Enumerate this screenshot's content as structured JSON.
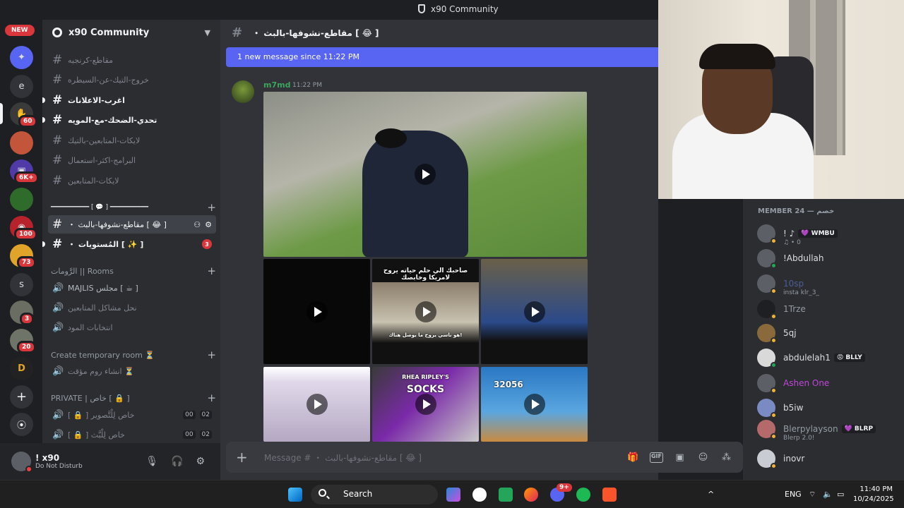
{
  "window": {
    "title": "x90 Community"
  },
  "rail": {
    "new_badge": "NEW",
    "letter_e": "e",
    "letter_s": "s",
    "badges": [
      "60",
      "6K+",
      "100",
      "73",
      "3",
      "20"
    ],
    "add_server": "+",
    "discover": "⦿"
  },
  "guild": {
    "name": "x90 Community",
    "text_channels": [
      "مقاطع-كرنجيه",
      "خروج-التيك-عن-السيطره",
      "اغرب-الاعلانات",
      "تحدي-الضحك-مع-المويه",
      "لايكات-المتابعين-بالتيك",
      "البرامج-اكثر-استعمال",
      "لايكات-المتابعين"
    ],
    "divider_label": "━━━━━━━━━━ [ 💬 ] ━━━━━━━━━━",
    "active_channel": "・ مقاطع-نشوفها-بالبث [ 😂 ]",
    "levels_channel": "・ المُستويات [ ✨ ]",
    "levels_count": "3",
    "rooms_category": "الرَّومات || Rooms",
    "voice_channels": [
      "MAJLIS مجلس [ ☕ ]",
      "نحل مشاكل المتابعين",
      "انتخابات المود"
    ],
    "temp_category": "Create temporary room ⏳",
    "temp_channel": "انشاء روم مؤقت ⏳",
    "private_category": "PRIVATE | خاص [ 🔒 ]",
    "private_channels": [
      {
        "name": "[ 🔒 ] خاص لِلْتَّصوير",
        "a": "00",
        "b": "02"
      },
      {
        "name": "[ 🔒 ] خاص لِلْبَّث",
        "a": "00",
        "b": "02"
      }
    ]
  },
  "user": {
    "name": "! x90",
    "status": "Do Not Disturb"
  },
  "chat": {
    "channel_title": "・ مقاطع-نشوفها-بالبث [ 😂 ]",
    "new_message_bar": "1 new message since 11:22 PM",
    "author": "m7md",
    "time": "11:22 PM",
    "caption_1": "صاحبك الي حلم حياته يروح لامريكا وخابصك",
    "caption_1b": "هو ناسي يروح ما يوصل هناك!",
    "caption_2": "32056",
    "caption_3": "SOCKS",
    "caption_3b": "RHEA RIPLEY'S",
    "placeholder": "Message # ・ مقاطع-نشوفها-بالبث [ 😂 ]",
    "tools": [
      "🎁",
      "GIF",
      "▣",
      "☺",
      "⁂"
    ]
  },
  "members": {
    "header": "MEMBER 24 — خصم",
    "list": [
      {
        "name": "! ♪",
        "tag": "💜 WMBU",
        "sub": "♫ • 0",
        "color": "#dbdee1"
      },
      {
        "name": "!Abdullah",
        "tag": "",
        "sub": "",
        "color": "#dbdee1"
      },
      {
        "name": "10sp",
        "tag": "",
        "sub": "insta klr_3_",
        "color": "#4e5d94"
      },
      {
        "name": "1Trze",
        "tag": "",
        "sub": "",
        "color": "#949ba4"
      },
      {
        "name": "5qj",
        "tag": "",
        "sub": "",
        "color": "#dbdee1"
      },
      {
        "name": "abdulelah1",
        "tag": "😡 BLLY",
        "sub": "",
        "color": "#dbdee1"
      },
      {
        "name": "Ashen One",
        "tag": "",
        "sub": "",
        "color": "#c046d8"
      },
      {
        "name": "b5iw",
        "tag": "",
        "sub": "",
        "color": "#dbdee1"
      },
      {
        "name": "Blerpylayson",
        "tag": "💜 BLRP",
        "sub": "Blerp 2.0!",
        "color": "#949ba4"
      },
      {
        "name": "inovr",
        "tag": "",
        "sub": "",
        "color": "#dbdee1"
      }
    ]
  },
  "taskbar": {
    "search": "Search",
    "lang": "ENG",
    "time": "11:40 PM",
    "date": "10/24/2025",
    "notif": "9+"
  }
}
